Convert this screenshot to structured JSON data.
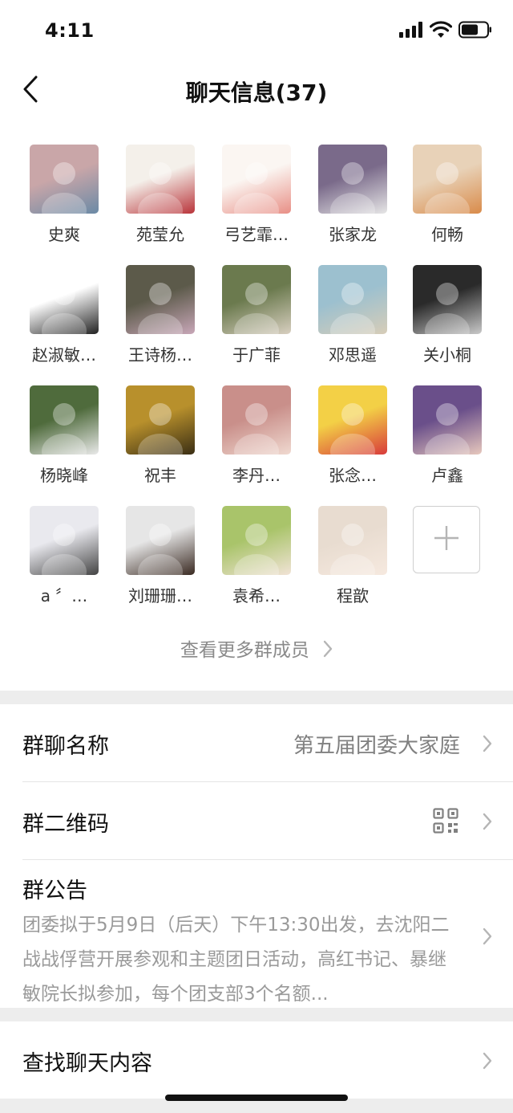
{
  "status_bar": {
    "time": "4:11"
  },
  "nav": {
    "title": "聊天信息(37)"
  },
  "members": [
    {
      "name": "史爽",
      "avatar": "photo-girl-pink",
      "colors": [
        "#c9a6a8",
        "#6b8aa6"
      ]
    },
    {
      "name": "苑莹允",
      "avatar": "drawing-girl-stretch",
      "colors": [
        "#f4f0ea",
        "#b9343a"
      ]
    },
    {
      "name": "弓艺霏…",
      "avatar": "cartoon-pig-crown",
      "colors": [
        "#fbf6f2",
        "#e88f86"
      ]
    },
    {
      "name": "张家龙",
      "avatar": "photo-man-white-shirt",
      "colors": [
        "#7a6a8a",
        "#e6e6e6"
      ]
    },
    {
      "name": "何畅",
      "avatar": "photo-corgi",
      "colors": [
        "#e8d2b8",
        "#d98b4a"
      ]
    },
    {
      "name": "赵淑敏…",
      "avatar": "cartoon-girl-sticker",
      "colors": [
        "#ffffff",
        "#222222"
      ]
    },
    {
      "name": "王诗杨…",
      "avatar": "photo-girl-indoors",
      "colors": [
        "#5c5a4a",
        "#c8a7b8"
      ]
    },
    {
      "name": "于广菲",
      "avatar": "photo-girl-flowers",
      "colors": [
        "#6b7a4e",
        "#d8cfc0"
      ]
    },
    {
      "name": "邓思遥",
      "avatar": "photo-beach",
      "colors": [
        "#9cc0cf",
        "#d7cdb8"
      ]
    },
    {
      "name": "关小桐",
      "avatar": "anime-white-hair",
      "colors": [
        "#2a2a2a",
        "#c9c9c9"
      ]
    },
    {
      "name": "杨晓峰",
      "avatar": "photo-man-sitting",
      "colors": [
        "#4f6b3c",
        "#e9e9e9"
      ]
    },
    {
      "name": "祝丰",
      "avatar": "photo-lights-yellow",
      "colors": [
        "#b8902c",
        "#3a2e14"
      ]
    },
    {
      "name": "李丹…",
      "avatar": "photo-girl-face",
      "colors": [
        "#c98f8a",
        "#f0d9d0"
      ]
    },
    {
      "name": "张念…",
      "avatar": "cartoon-pig-strawberries",
      "colors": [
        "#f3d046",
        "#d83b3b"
      ]
    },
    {
      "name": "卢鑫",
      "avatar": "photo-couple",
      "colors": [
        "#6a4f8a",
        "#e7c8bd"
      ]
    },
    {
      "name": "a 〞…",
      "avatar": "photo-woman-office",
      "colors": [
        "#e9e9ee",
        "#444444"
      ]
    },
    {
      "name": "刘珊珊…",
      "avatar": "photo-woman-smiling",
      "colors": [
        "#e6e6e6",
        "#3a2a22"
      ]
    },
    {
      "name": "袁希…",
      "avatar": "photo-child-field",
      "colors": [
        "#a9c46a",
        "#f1e3d6"
      ]
    },
    {
      "name": "程歆",
      "avatar": "photo-baby-hood",
      "colors": [
        "#e8dcd0",
        "#f6e9df"
      ]
    }
  ],
  "add_member": {
    "icon": "plus-icon"
  },
  "more_members": {
    "label": "查看更多群成员"
  },
  "settings": {
    "group_name_label": "群聊名称",
    "group_name_value": "第五届团委大家庭",
    "qr_label": "群二维码",
    "notice_label": "群公告",
    "notice_text": "团委拟于5月9日（后天）下午13:30出发，去沈阳二战战俘营开展参观和主题团日活动，高红书记、暴继敏院长拟参加，每个团支部3个名额...",
    "search_label": "查找聊天内容"
  }
}
